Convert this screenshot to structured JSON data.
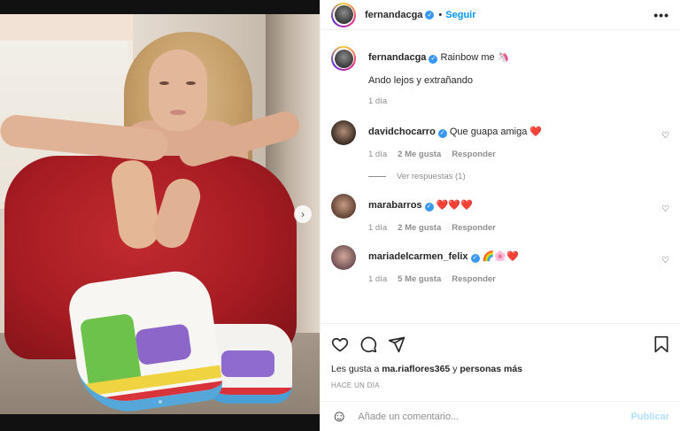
{
  "post": {
    "author": "fernandacga",
    "follow_label": "Seguir",
    "separator": "•",
    "more_label": "•••",
    "next_arrow": "›",
    "slide_count": 2
  },
  "caption": {
    "username": "fernandacga",
    "text": "Rainbow me 🦄",
    "extra": "Ando lejos y extrañando",
    "time": "1 día"
  },
  "comments": [
    {
      "username": "davidchocarro",
      "verified": true,
      "text": "Que guapa amiga ❤️",
      "time": "1 día",
      "likes": "2 Me gusta",
      "reply": "Responder",
      "view_replies": "Ver respuestas (1)"
    },
    {
      "username": "marabarros",
      "verified": true,
      "text": "❤️❤️❤️",
      "time": "1 día",
      "likes": "2 Me gusta",
      "reply": "Responder"
    },
    {
      "username": "mariadelcarmen_felix",
      "verified": true,
      "text": "🌈🌸❤️",
      "time": "1 día",
      "likes": "5 Me gusta",
      "reply": "Responder"
    }
  ],
  "likes_line": {
    "prefix": "Les gusta a",
    "user": "ma.riaflores365",
    "connector": "y",
    "rest": "personas más"
  },
  "posted_ago": "HACE UN DÍA",
  "comment_box": {
    "placeholder": "Añade un comentario...",
    "publish": "Publicar"
  },
  "colors": {
    "accent": "#0095f6",
    "verified": "#3897f0",
    "heart": "#ed1c24"
  },
  "icons": [
    "heart-icon",
    "comment-icon",
    "share-icon",
    "bookmark-icon",
    "emoji-icon",
    "next-arrow-icon",
    "more-icon",
    "verified-icon"
  ]
}
